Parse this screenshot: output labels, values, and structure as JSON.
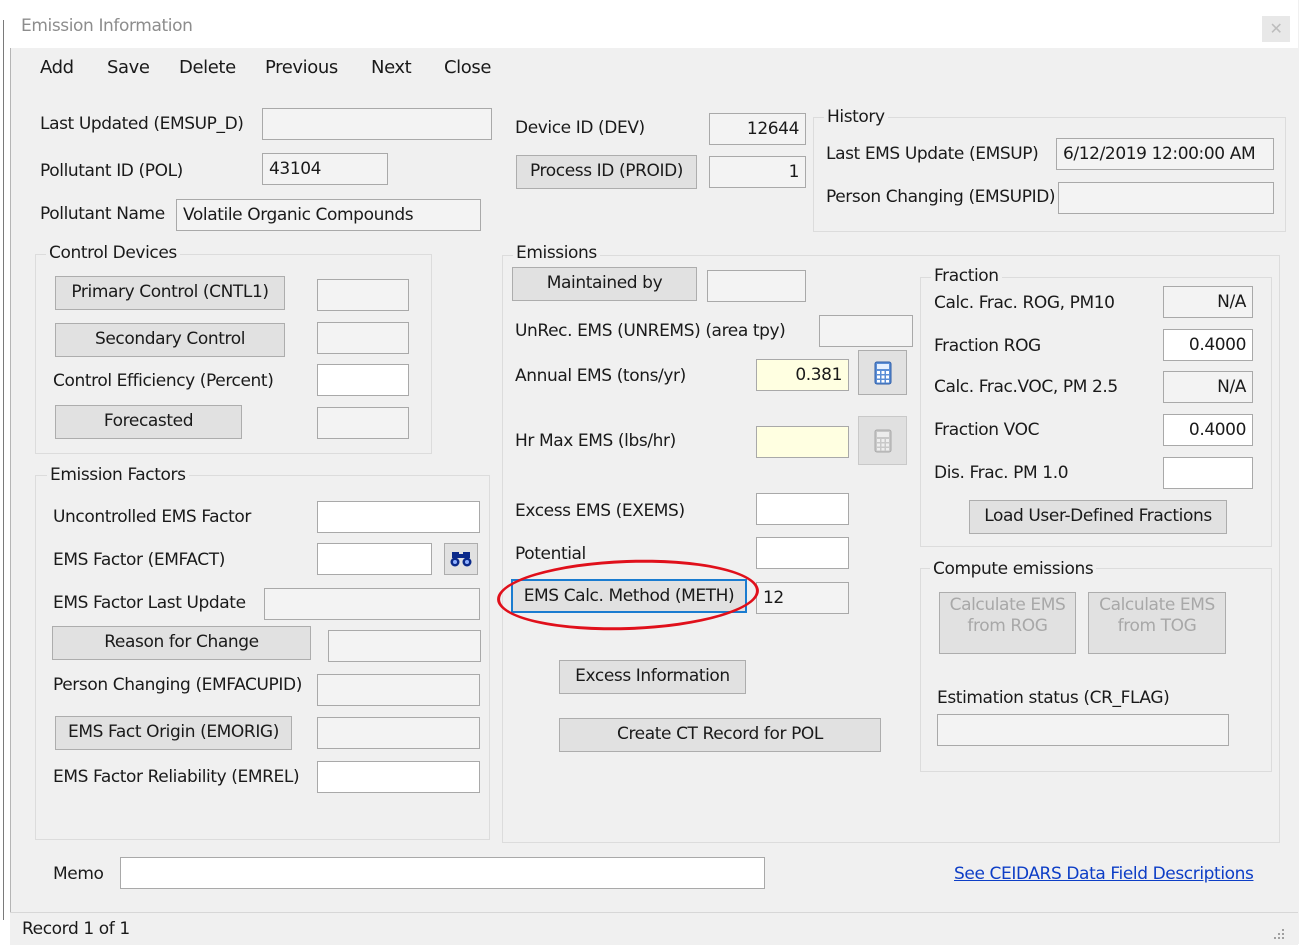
{
  "window": {
    "title": "Emission Information"
  },
  "menu": [
    {
      "label": "Add"
    },
    {
      "label": "Save"
    },
    {
      "label": "Delete"
    },
    {
      "label": "Previous"
    },
    {
      "label": "Next"
    },
    {
      "label": "Close"
    }
  ],
  "top": {
    "last_updated_label": "Last Updated (EMSUP_D)",
    "last_updated_value": "",
    "pollutant_id_label": "Pollutant ID (POL)",
    "pollutant_id_value": "43104",
    "pollutant_name_label": "Pollutant Name",
    "pollutant_name_value": "Volatile Organic Compounds",
    "device_id_label": "Device ID (DEV)",
    "device_id_value": "12644",
    "process_id_button": "Process ID (PROID)",
    "process_id_value": "1"
  },
  "history": {
    "title": "History",
    "last_ems_update_label": "Last EMS Update (EMSUP)",
    "last_ems_update_value": "6/12/2019 12:00:00 AM",
    "person_changing_label": "Person Changing (EMSUPID)",
    "person_changing_value": ""
  },
  "control_devices": {
    "title": "Control Devices",
    "primary_button": "Primary Control (CNTL1)",
    "secondary_button": "Secondary Control",
    "efficiency_label": "Control Efficiency (Percent)",
    "forecasted_button": "Forecasted"
  },
  "emission_factors": {
    "title": "Emission Factors",
    "uncontrolled_label": "Uncontrolled EMS Factor",
    "ems_factor_label": "EMS Factor (EMFACT)",
    "last_update_label": "EMS Factor Last Update",
    "reason_button": "Reason for Change",
    "person_changing_label": "Person Changing (EMFACUPID)",
    "origin_button": "EMS Fact Origin (EMORIG)",
    "reliability_label": "EMS Factor Reliability  (EMREL)"
  },
  "emissions": {
    "title": "Emissions",
    "maintained_by_button": "Maintained by",
    "unrec_label": "UnRec. EMS (UNREMS) (area tpy)",
    "annual_label": "Annual EMS (tons/yr)",
    "annual_value": "0.381",
    "hr_max_label": "Hr Max EMS (lbs/hr)",
    "hr_max_value": "",
    "excess_label": "Excess EMS (EXEMS)",
    "potential_label": "Potential",
    "calc_method_button": "EMS Calc. Method (METH)",
    "calc_method_value": "12",
    "excess_info_button": "Excess Information",
    "create_ct_button": "Create CT Record for POL"
  },
  "fraction": {
    "title": "Fraction",
    "calc_rog_label": "Calc. Frac. ROG, PM10",
    "calc_rog_value": "N/A",
    "rog_label": "Fraction ROG",
    "rog_value": "0.4000",
    "calc_voc_label": "Calc. Frac.VOC, PM 2.5",
    "calc_voc_value": "N/A",
    "voc_label": "Fraction VOC",
    "voc_value": "0.4000",
    "dis_label": "Dis. Frac. PM 1.0",
    "dis_value": "",
    "load_button": "Load User-Defined Fractions"
  },
  "compute": {
    "title": "Compute emissions",
    "rog_button_line1": "Calculate EMS",
    "rog_button_line2": "from ROG",
    "tog_button_line1": "Calculate EMS",
    "tog_button_line2": "from TOG",
    "status_label": "Estimation status (CR_FLAG)",
    "status_value": ""
  },
  "memo": {
    "label": "Memo",
    "value": ""
  },
  "link": {
    "text": "See CEIDARS Data Field Descriptions"
  },
  "status": {
    "record": "Record 1 of 1"
  },
  "colors": {
    "annotation": "#e0101b",
    "focus": "#1a7cd0",
    "link": "#0d3ec6"
  }
}
